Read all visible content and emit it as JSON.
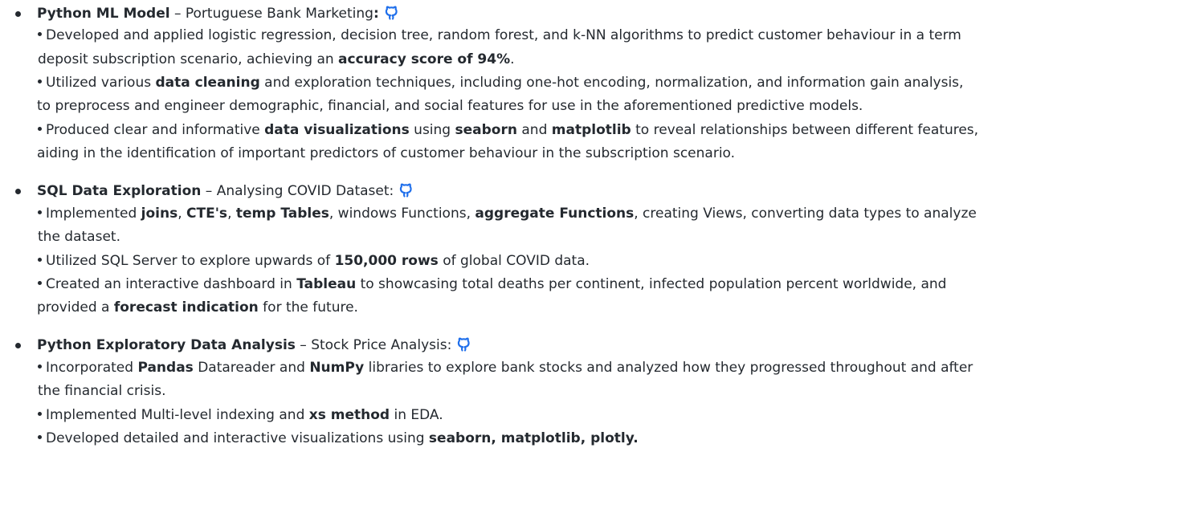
{
  "projects": [
    {
      "title": "Python ML Model",
      "separator": " – ",
      "subtitle": "Portuguese Bank Marketing",
      "suffix": ":",
      "icon": "github-icon",
      "lines": [
        [
          {
            "t": "Developed and applied logistic regression, decision tree, random forest, and k-NN algorithms to predict customer behaviour in a term",
            "b": false
          }
        ],
        [
          {
            "t": "deposit subscription scenario, achieving an ",
            "b": false
          },
          {
            "t": "accuracy score of 94%",
            "b": true
          },
          {
            "t": ".",
            "b": false
          }
        ],
        [
          {
            "t": "Utilized various ",
            "b": false
          },
          {
            "t": "data cleaning",
            "b": true
          },
          {
            "t": " and exploration techniques, including one-hot encoding, normalization, and information gain analysis,",
            "b": false
          }
        ],
        [
          {
            "t": "to preprocess and engineer demographic, financial, and social features for use in the aforementioned predictive models.",
            "b": false
          }
        ],
        [
          {
            "t": "Produced clear and informative ",
            "b": false
          },
          {
            "t": "data visualizations",
            "b": true
          },
          {
            "t": " using ",
            "b": false
          },
          {
            "t": "seaborn",
            "b": true
          },
          {
            "t": " and ",
            "b": false
          },
          {
            "t": "matplotlib",
            "b": true
          },
          {
            "t": " to reveal relationships between different features,",
            "b": false
          }
        ],
        [
          {
            "t": "aiding in the identification of important predictors of customer behaviour in the subscription scenario.",
            "b": false
          }
        ]
      ]
    },
    {
      "title": "SQL Data Exploration",
      "separator": " – ",
      "subtitle": "Analysing COVID Dataset:",
      "suffix": "",
      "icon": "github-icon",
      "lines": [
        [
          {
            "t": "Implemented ",
            "b": false
          },
          {
            "t": "joins",
            "b": true
          },
          {
            "t": ", ",
            "b": false
          },
          {
            "t": "CTE's",
            "b": true
          },
          {
            "t": ", ",
            "b": false
          },
          {
            "t": "temp Tables",
            "b": true
          },
          {
            "t": ", windows Functions, ",
            "b": false
          },
          {
            "t": "aggregate Functions",
            "b": true
          },
          {
            "t": ", creating Views, converting data types to analyze",
            "b": false
          }
        ],
        [
          {
            "t": "the dataset.",
            "b": false
          }
        ],
        [
          {
            "t": "Utilized SQL Server to explore upwards of ",
            "b": false
          },
          {
            "t": "150,000 rows",
            "b": true
          },
          {
            "t": " of global COVID data.",
            "b": false
          }
        ],
        [
          {
            "t": "Created an interactive dashboard in ",
            "b": false
          },
          {
            "t": "Tableau",
            "b": true
          },
          {
            "t": " to showcasing total deaths per continent, infected population percent worldwide, and",
            "b": false
          }
        ],
        [
          {
            "t": "provided a ",
            "b": false
          },
          {
            "t": "forecast indication",
            "b": true
          },
          {
            "t": " for the future.",
            "b": false
          }
        ]
      ]
    },
    {
      "title": "Python Exploratory Data Analysis",
      "separator": " – ",
      "subtitle": "Stock Price Analysis:",
      "suffix": "",
      "icon": "github-icon",
      "lines": [
        [
          {
            "t": "Incorporated ",
            "b": false
          },
          {
            "t": "Pandas",
            "b": true
          },
          {
            "t": " Datareader and ",
            "b": false
          },
          {
            "t": "NumPy",
            "b": true
          },
          {
            "t": " libraries to explore bank stocks and analyzed how they progressed throughout and after",
            "b": false
          }
        ],
        [
          {
            "t": "the financial crisis.",
            "b": false
          }
        ],
        [
          {
            "t": "Implemented Multi-level indexing and ",
            "b": false
          },
          {
            "t": "xs method",
            "b": true
          },
          {
            "t": " in EDA.",
            "b": false
          }
        ],
        [
          {
            "t": "Developed detailed and interactive visualizations using ",
            "b": false
          },
          {
            "t": "seaborn, matplotlib, plotly.",
            "b": true
          }
        ]
      ]
    }
  ],
  "colors": {
    "text": "#24292f",
    "background": "#ffffff"
  }
}
